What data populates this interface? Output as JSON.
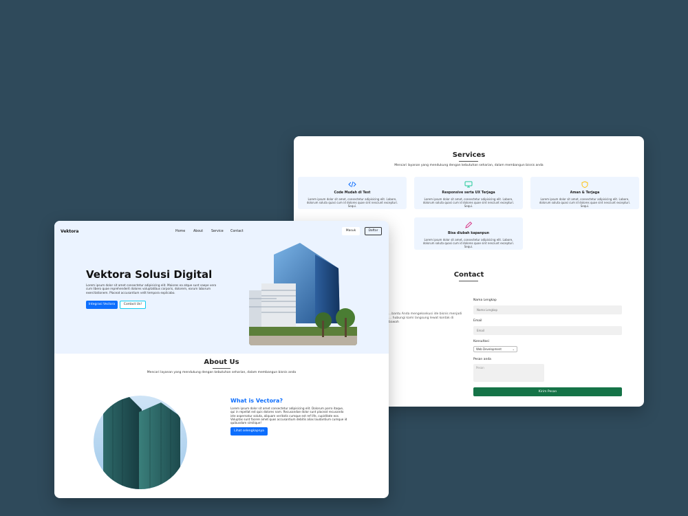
{
  "services": {
    "title": "Services",
    "subtitle": "Mencari layanan yang mendukung dengan kebutuhan seharian, dalam membangun bisnis anda",
    "items": [
      {
        "icon": "code-icon",
        "title": "Code Mudah di Test",
        "desc": "Lorem ipsum dolor sit amet, consectetur adipisicing elit. Labore, dolorum soluta quasi cum id dolores quae sint nesciunt excepturi. Sequi."
      },
      {
        "icon": "monitor-icon",
        "title": "Responsive serta UX Terjaga",
        "desc": "Lorem ipsum dolor sit amet, consectetur adipisicing elit. Labore, dolorum soluta quasi cum id dolores quae sint nesciunt excepturi. Sequi."
      },
      {
        "icon": "shield-icon",
        "title": "Aman & Terjaga",
        "desc": "Lorem ipsum dolor sit amet, consectetur adipisicing elit. Labore, dolorum soluta quasi cum id dolores quae sint nesciunt excepturi. Sequi."
      },
      {
        "icon": "pencil-icon",
        "title": "Bisa diubah kapanpun",
        "desc": "Lorem ipsum dolor sit amet, consectetur adipisicing elit. Labore, dolorum soluta quasi cum id dolores quae sint nesciunt excepturi. Sequi."
      }
    ]
  },
  "contact": {
    "title": "Contact",
    "intro": "...bantu Anda mengeksekusi ide bisnis menjadi ... hubungi kami langsung lewat kontak di bawah",
    "name_label": "Nama Lengkap",
    "name_placeholder": "Nama Lengkap",
    "email_label": "Email",
    "email_placeholder": "Email",
    "consult_label": "Konsultasi",
    "consult_selected": "Web Development",
    "message_label": "Pesan anda",
    "message_placeholder": "Pesan",
    "submit": "Kirim Pesan"
  },
  "nav": {
    "brand": "Vektora",
    "links": [
      "Home",
      "About",
      "Service",
      "Contact"
    ],
    "login": "Masuk",
    "register": "Daftar"
  },
  "hero": {
    "title": "Vektora Solusi Digital",
    "desc": "Lorem ipsum dolor sit amet consectetur adipisicing elit. Maiores ea atque sunt saepe vero cum libero quae reprehenderit dolores voluptatibus corporis, dolorem, earum laborum exercitationem. Placeat accusantium velit tempora explicabo.",
    "cta_primary": "Integrasi Vectora",
    "cta_secondary": "Contact Us!"
  },
  "about": {
    "title": "About Us",
    "subtitle": "Mencari layanan yang mendukung dengan kebutuhan seharian, dalam membangun bisnis anda",
    "heading": "What is Vectora?",
    "text": "Lorem ipsum dolor sit amet consectetur adipisicing elit. Dolorum porro itaque, qui in repellat est quis dolores nam. Recusandae dolor sunt placeat recusando iste aspernatur soluta, aliquam veritatis cumque est ref life, cupiditate eos. Voluptas sunt facere amet quos accusantium debitis alias laudantium cumque id quibusdam similique!",
    "button": "Lihat selengkapnya"
  },
  "colors": {
    "background": "#2f4a5b",
    "primary": "#0d6efd",
    "submit": "#157347",
    "hero_bg": "#ebf3ff",
    "service_bg": "#eef5ff"
  }
}
